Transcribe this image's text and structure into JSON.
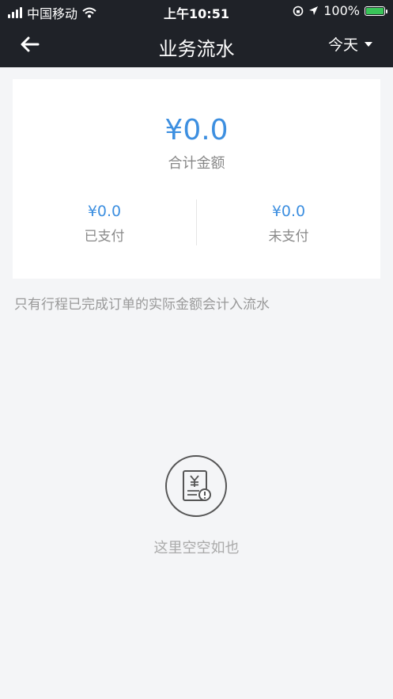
{
  "status_bar": {
    "carrier": "中国移动",
    "time": "上午10:51",
    "battery": "100%"
  },
  "nav": {
    "title": "业务流水",
    "date_filter": "今天"
  },
  "summary": {
    "total_amount": "¥0.0",
    "total_label": "合计金额",
    "paid_amount": "¥0.0",
    "paid_label": "已支付",
    "unpaid_amount": "¥0.0",
    "unpaid_label": "未支付"
  },
  "note": "只有行程已完成订单的实际金额会计入流水",
  "empty": {
    "text": "这里空空如也",
    "icon": "receipt-icon"
  },
  "colors": {
    "accent": "#3d8fe0",
    "header_bg": "#1f2228",
    "battery_green": "#39c559"
  }
}
